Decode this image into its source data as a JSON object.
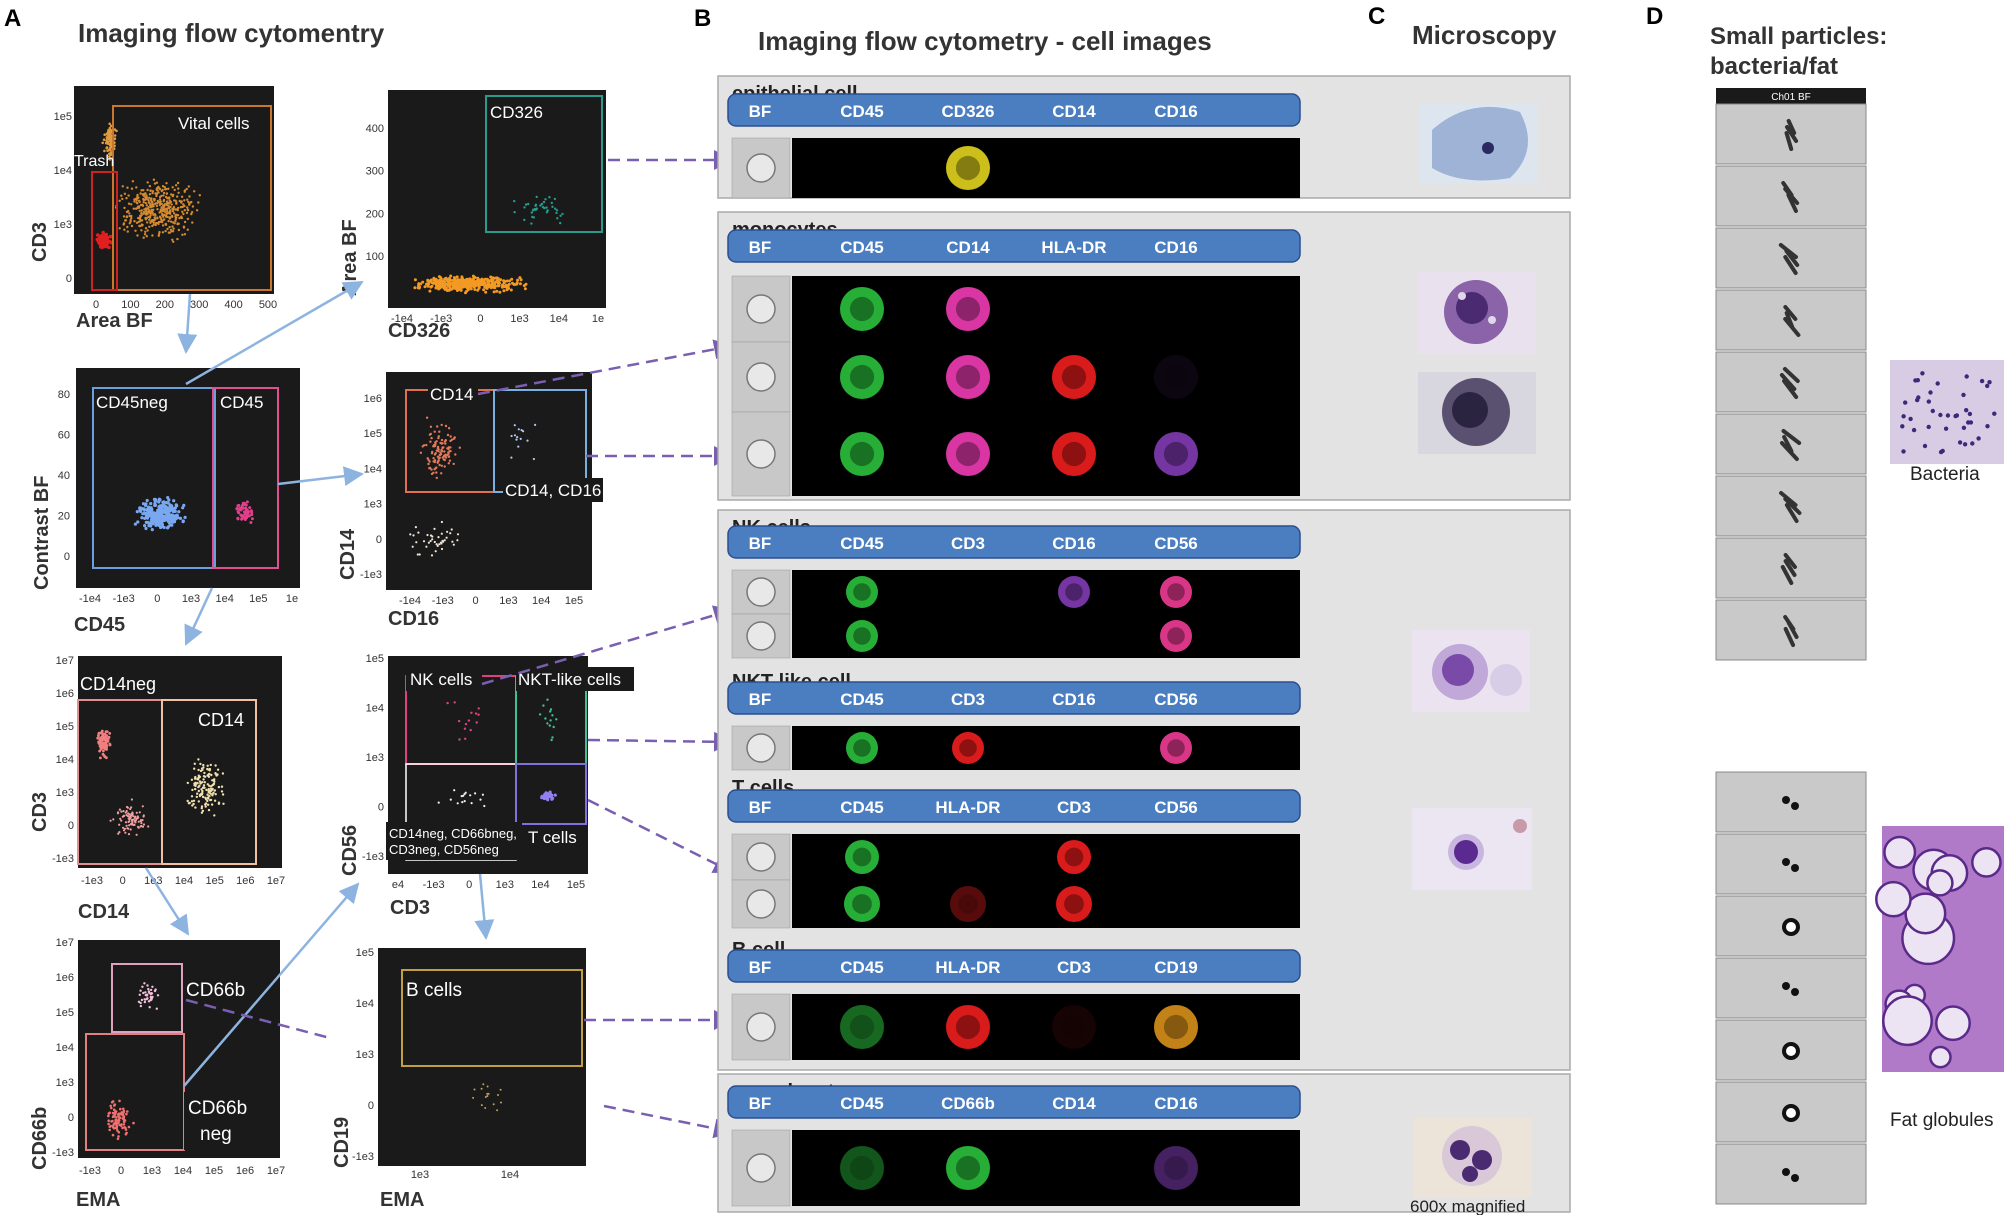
{
  "panels": {
    "a": {
      "letter": "A",
      "title": "Imaging flow cytomentry",
      "plots": [
        {
          "id": "p1",
          "x_label": "Area BF",
          "y_label": "CD3",
          "x_ticks": [
            "0",
            "100",
            "200",
            "300",
            "400",
            "500"
          ],
          "y_ticks": [
            "1e5",
            "1e4",
            "1e3",
            "0"
          ],
          "gates": [
            {
              "label": "Vital cells",
              "color": "#c8782c"
            },
            {
              "label": "Trash",
              "color": "#d02020"
            }
          ]
        },
        {
          "id": "p2",
          "x_label": "CD326",
          "y_label": "Area BF",
          "x_ticks": [
            "-1e4",
            "-1e3",
            "0",
            "1e3",
            "1e4",
            "1e"
          ],
          "y_ticks": [
            "400",
            "300",
            "200",
            "100"
          ],
          "gates": [
            {
              "label": "CD326",
              "color": "#2a9a8a"
            }
          ]
        },
        {
          "id": "p3",
          "x_label": "CD45",
          "y_label": "Contrast BF",
          "x_ticks": [
            "-1e4",
            "-1e3",
            "0",
            "1e3",
            "1e4",
            "1e5",
            "1e"
          ],
          "y_ticks": [
            "80",
            "60",
            "40",
            "20",
            "0"
          ],
          "gates": [
            {
              "label": "CD45neg",
              "color": "#6aa0e0"
            },
            {
              "label": "CD45",
              "color": "#e05090"
            }
          ]
        },
        {
          "id": "p4",
          "x_label": "CD16",
          "y_label": "CD14",
          "x_ticks": [
            "-1e4",
            "-1e3",
            "0",
            "1e3",
            "1e4",
            "1e5"
          ],
          "y_ticks": [
            "1e6",
            "1e5",
            "1e4",
            "1e3",
            "0",
            "-1e3"
          ],
          "gates": [
            {
              "label": "CD14",
              "color": "#e07050"
            },
            {
              "label": "CD14, CD16",
              "color": "#7ab0e0"
            }
          ]
        },
        {
          "id": "p5",
          "x_label": "CD14",
          "y_label": "CD3",
          "x_ticks": [
            "-1e3",
            "0",
            "1e3",
            "1e4",
            "1e5",
            "1e6",
            "1e7"
          ],
          "y_ticks": [
            "1e7",
            "1e6",
            "1e5",
            "1e4",
            "1e3",
            "0",
            "-1e3"
          ],
          "gates": [
            {
              "label": "CD14neg",
              "color": "#e09090"
            },
            {
              "label": "CD14",
              "color": "#f0c0a0"
            }
          ]
        },
        {
          "id": "p6",
          "x_label": "CD3",
          "y_label": "CD56",
          "x_ticks": [
            "e4",
            "-1e3",
            "0",
            "1e3",
            "1e4",
            "1e5"
          ],
          "y_ticks": [
            "1e5",
            "1e4",
            "1e3",
            "0",
            "-1e3"
          ],
          "gates": [
            {
              "label": "NK cells",
              "color": "#e04080"
            },
            {
              "label": "NKT-like cells",
              "color": "#40c090"
            },
            {
              "label": "CD14neg, CD66bneg, CD3neg, CD56neg",
              "color": "#ffffff"
            },
            {
              "label": "T cells",
              "color": "#8070e0"
            }
          ]
        },
        {
          "id": "p7",
          "x_label": "EMA",
          "y_label": "CD66b",
          "x_ticks": [
            "-1e3",
            "0",
            "1e3",
            "1e4",
            "1e5",
            "1e6",
            "1e7"
          ],
          "y_ticks": [
            "1e7",
            "1e6",
            "1e5",
            "1e4",
            "1e3",
            "0",
            "-1e3"
          ],
          "gates": [
            {
              "label": "CD66b",
              "color": "#e0a0c0"
            },
            {
              "label": "CD66b neg",
              "color": "#e08080"
            }
          ]
        },
        {
          "id": "p8",
          "x_label": "EMA",
          "y_label": "CD19",
          "x_ticks": [
            "1e3",
            "1e4"
          ],
          "y_ticks": [
            "1e5",
            "1e4",
            "1e3",
            "0",
            "-1e3"
          ],
          "gates": [
            {
              "label": "B cells",
              "color": "#c0a040"
            }
          ]
        }
      ]
    },
    "b": {
      "letter": "B",
      "title": "Imaging flow cytometry - cell images",
      "groups": [
        {
          "label": "epithelial cell",
          "channels": [
            "BF",
            "CD45",
            "CD326",
            "CD14",
            "CD16"
          ]
        },
        {
          "label": "monocytes",
          "channels": [
            "BF",
            "CD45",
            "CD14",
            "HLA-DR",
            "CD16"
          ]
        },
        {
          "label": "NK cells",
          "channels": [
            "BF",
            "CD45",
            "CD3",
            "CD16",
            "CD56"
          ]
        },
        {
          "label": "NKT-like cell",
          "channels": [
            "BF",
            "CD45",
            "CD3",
            "CD16",
            "CD56"
          ]
        },
        {
          "label": "T cells",
          "channels": [
            "BF",
            "CD45",
            "HLA-DR",
            "CD3",
            "CD56"
          ]
        },
        {
          "label": "B cell",
          "channels": [
            "BF",
            "CD45",
            "HLA-DR",
            "CD3",
            "CD19"
          ]
        },
        {
          "label": "granulocyte",
          "channels": [
            "BF",
            "CD45",
            "CD66b",
            "CD14",
            "CD16"
          ]
        }
      ]
    },
    "c": {
      "letter": "C",
      "title": "Microscopy",
      "magnification": "600x magnified"
    },
    "d": {
      "letter": "D",
      "title": "Small particles: bacteria/fat",
      "strip_header": "Ch01 BF",
      "bacteria_label": "Bacteria",
      "fat_label": "Fat globules"
    }
  },
  "colors": {
    "plot_bg": "#1a1a1a",
    "channel_header": "#4a7ec0",
    "arrow_blue": "#8db4e0",
    "arrow_purple": "#7a5fb0",
    "panel_bg": "#e3e3e3"
  }
}
